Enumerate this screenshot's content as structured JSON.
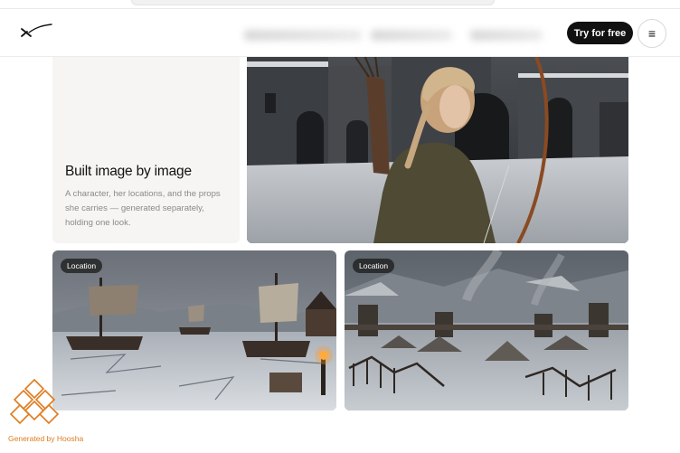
{
  "navbar": {
    "cta_label": "Try for free",
    "logo_icon": "x-mark-logo-icon",
    "menu_icon": "hamburger-menu-icon"
  },
  "intro_card": {
    "title": "Built image by image",
    "description": "A character, her locations, and the props she carries — generated separately, holding one look."
  },
  "gallery": {
    "location_card_1": {
      "badge": "Location"
    },
    "location_card_2": {
      "badge": "Location"
    }
  },
  "watermark": {
    "text": "Generated by Hoosha"
  },
  "colors": {
    "cta_background": "#111111",
    "card_background": "#f6f5f3",
    "watermark_orange": "#e07b1f"
  }
}
